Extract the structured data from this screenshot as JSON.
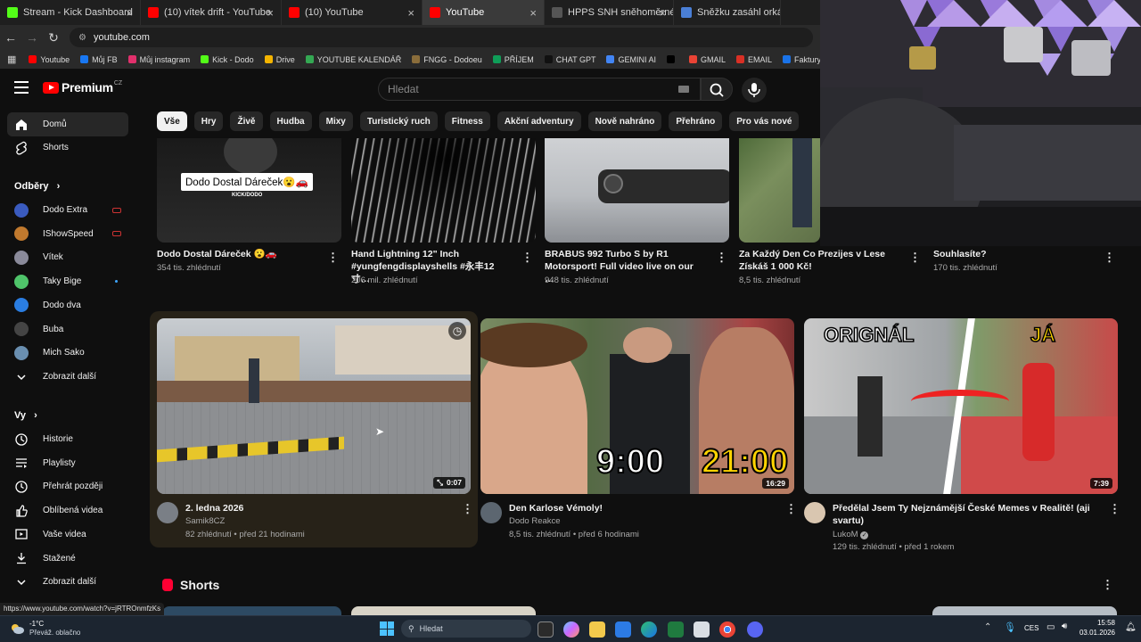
{
  "browser": {
    "tabs": [
      {
        "title": "Stream - Kick Dashboard",
        "color": "#53fc18",
        "active": false
      },
      {
        "title": "(10) vítek drift - YouTube",
        "color": "#ff0000",
        "active": false
      },
      {
        "title": "(10) YouTube",
        "color": "#ff0000",
        "active": false
      },
      {
        "title": "YouTube",
        "color": "#ff0000",
        "active": true
      },
      {
        "title": "HPPS SNH sněhoměrné stanice",
        "color": "#555555",
        "active": false
      },
      {
        "title": "Sněžku zasáhl orkán, v",
        "color": "#4a7fd6",
        "active": false
      }
    ],
    "url": "youtube.com",
    "bookmarks": [
      {
        "label": "Youtube",
        "color": "#ff0000"
      },
      {
        "label": "Můj FB",
        "color": "#1877f2"
      },
      {
        "label": "Můj instagram",
        "color": "#e1306c"
      },
      {
        "label": "Kick - Dodo",
        "color": "#53fc18"
      },
      {
        "label": "Drive",
        "color": "#f4b400"
      },
      {
        "label": "YOUTUBE KALENDÁŘ",
        "color": "#34a853"
      },
      {
        "label": "FNGG - Dodoeu",
        "color": "#8a6d3b"
      },
      {
        "label": "PŘÍJEM",
        "color": "#0f9d58"
      },
      {
        "label": "CHAT GPT",
        "color": "#111111"
      },
      {
        "label": "GEMINI AI",
        "color": "#4285f4"
      },
      {
        "label": "",
        "color": "#000000"
      },
      {
        "label": "GMAIL",
        "color": "#ea4335"
      },
      {
        "label": "EMAIL",
        "color": "#d93025"
      },
      {
        "label": "Faktury - Vytváření",
        "color": "#1a73e8"
      },
      {
        "label": "P",
        "color": "#c5221f"
      }
    ],
    "status_url": "https://www.youtube.com/watch?v=jRTROnmfzKs"
  },
  "header": {
    "logo_word": "Premium",
    "logo_region": "CZ",
    "search_placeholder": "Hledat"
  },
  "chips": [
    "Vše",
    "Hry",
    "Živě",
    "Hudba",
    "Mixy",
    "Turistický ruch",
    "Fitness",
    "Akční adventury",
    "Nově nahráno",
    "Přehráno",
    "Pro vás nové"
  ],
  "sidebar": {
    "main": [
      {
        "label": "Domů",
        "icon": "home-icon"
      },
      {
        "label": "Shorts",
        "icon": "shorts-icon"
      }
    ],
    "subscriptions_heading": "Odběry",
    "subscriptions": [
      {
        "label": "Dodo Extra",
        "color": "#3a5bbf",
        "live": true
      },
      {
        "label": "IShowSpeed",
        "color": "#c0792e",
        "live": true
      },
      {
        "label": "Vítek",
        "color": "#8a8a9a",
        "live": false
      },
      {
        "label": "Taky Bige",
        "color": "#4fc46a",
        "live": false,
        "new": true
      },
      {
        "label": "Dodo dva",
        "color": "#2a7de1",
        "live": false
      },
      {
        "label": "Buba",
        "color": "#444444",
        "live": false
      },
      {
        "label": "Mich Sako",
        "color": "#6a8fb0",
        "live": false
      }
    ],
    "show_more": "Zobrazit další",
    "you_heading": "Vy",
    "you_items": [
      {
        "label": "Historie",
        "icon": "history-icon"
      },
      {
        "label": "Playlisty",
        "icon": "playlist-icon"
      },
      {
        "label": "Přehrát později",
        "icon": "watch-later-icon"
      },
      {
        "label": "Oblíbená videa",
        "icon": "like-icon"
      },
      {
        "label": "Vaše videa",
        "icon": "your-videos-icon"
      },
      {
        "label": "Stažené",
        "icon": "download-icon"
      }
    ],
    "you_show_more": "Zobrazit další"
  },
  "top_row": [
    {
      "title": "Dodo Dostal Dáreček 😮🚗",
      "meta": "354 tis. zhlédnutí",
      "thumb_text": "Dodo Dostal Dáreček😮🚗",
      "thumb_sub": "KICK/DODO"
    },
    {
      "title": "Hand Lightning 12\" Inch #yungfengdisplayshells #永丰12寸…",
      "meta": "206 mil. zhlédnutí"
    },
    {
      "title": "BRABUS 992 Turbo S by R1 Motorsport! Full video live on our …",
      "meta": "948 tis. zhlédnutí"
    },
    {
      "title": "Za Každý Den Co Prezijes v Lese Získáš 1 000 Kč!",
      "meta": "8,5 tis. zhlédnutí"
    },
    {
      "title": "Souhlasíte?",
      "meta": "170 tis. zhlédnutí"
    }
  ],
  "videos": [
    {
      "title": "2. ledna 2026",
      "channel": "Samik8CZ",
      "meta": "82 zhlédnutí • před 21 hodinami",
      "duration": "0:07",
      "avatar_color": "#7a7f86"
    },
    {
      "title": "Den Karlose Vémoly!",
      "channel": "Dodo Reakce",
      "meta": "8,5 tis. zhlédnutí • před 6 hodinami",
      "duration": "16:29",
      "thumb_left": "9:00",
      "thumb_right": "21:00",
      "avatar_color": "#5c6670"
    },
    {
      "title": "Předělal Jsem Ty Nejznámější České Memes v Realitě! (aji svartu)",
      "channel": "LukoM",
      "meta": "129 tis. zhlédnutí • před 1 rokem",
      "duration": "7:39",
      "thumb_left": "ORIGNÁL",
      "thumb_right": "JÁ",
      "avatar_color": "#d9c6b0"
    }
  ],
  "shorts_heading": "Shorts",
  "taskbar": {
    "weather_temp": "-1°C",
    "weather_text": "Převáž. oblačno",
    "search_placeholder": "Hledat",
    "lang": "CES",
    "time": "15:58",
    "date": "03.01.2026"
  }
}
